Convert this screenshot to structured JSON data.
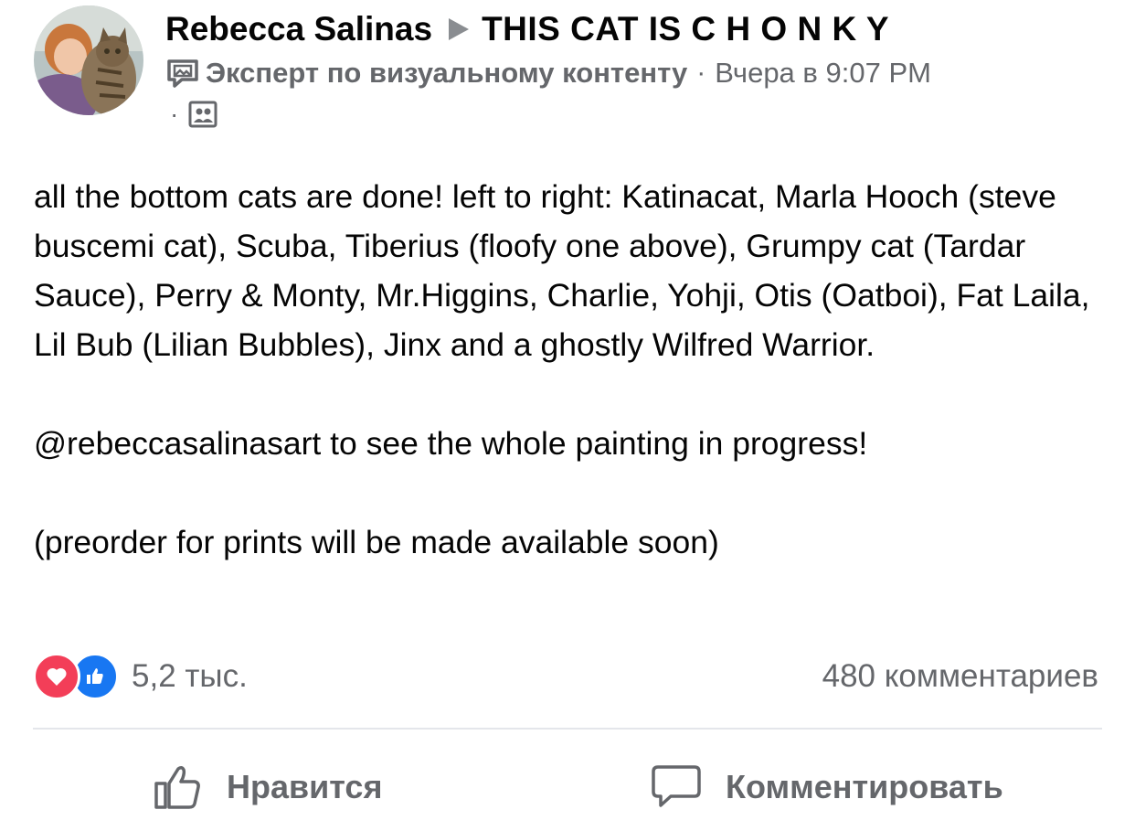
{
  "post": {
    "author": "Rebecca Salinas",
    "group": "THIS CAT IS C H O N K Y",
    "badge": "Эксперт по визуальному контенту",
    "separator": "·",
    "time": "Вчера в 9:07 PM",
    "audience_icon": "group-audience-icon",
    "body": [
      "all the bottom cats are done! left to right: Katinacat, Marla Hooch (steve buscemi cat), Scuba, Tiberius (floofy one above), Grumpy cat (Tardar Sauce), Perry & Monty, Mr.Higgins, Charlie, Yohji, Otis (Oatboi), Fat Laila, Lil Bub (Lilian Bubbles), Jinx and a ghostly Wilfred Warrior.",
      "@rebeccasalinasart to see the whole painting in progress!",
      "(preorder for prints will be made available soon)"
    ]
  },
  "reactions": {
    "count": "5,2 тыс.",
    "types": [
      "love",
      "like"
    ],
    "comments": "480 комментариев"
  },
  "actions": {
    "like_label": "Нравится",
    "comment_label": "Комментировать"
  },
  "colors": {
    "secondary_text": "#65676b",
    "love": "#f33e58",
    "like": "#1877f2",
    "divider": "#e4e6eb"
  }
}
